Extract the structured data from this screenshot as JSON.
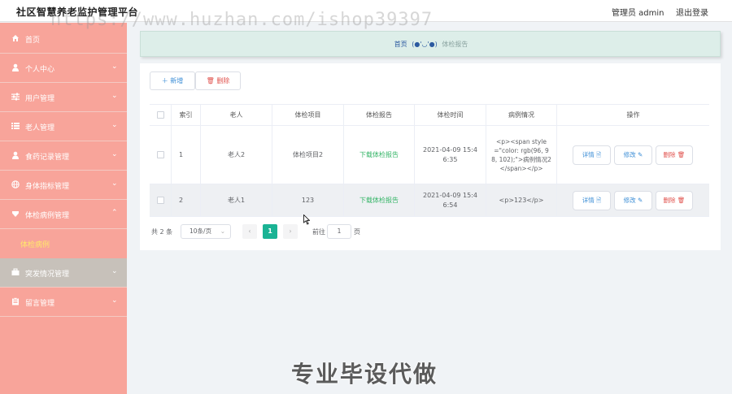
{
  "app": {
    "title": "社区智慧养老监护管理平台",
    "user_label": "管理员 admin",
    "logout_label": "退出登录"
  },
  "watermark": "https://www.huzhan.com/ishop39397",
  "footer_watermark": "专业毕设代做",
  "colors": {
    "sidebar_bg": "#f8a49a",
    "active_sub": "#ffe86b",
    "primary": "#1ab394",
    "download": "#35b567",
    "danger": "#e0514c",
    "link": "#3b8dd6"
  },
  "sidebar": {
    "items": [
      {
        "label": "首页",
        "icon": "home-icon",
        "expandable": false
      },
      {
        "label": "个人中心",
        "icon": "person-icon",
        "expandable": true
      },
      {
        "label": "用户管理",
        "icon": "sliders-icon",
        "expandable": true
      },
      {
        "label": "老人管理",
        "icon": "list-icon",
        "expandable": true
      },
      {
        "label": "食药记录管理",
        "icon": "person-icon",
        "expandable": true
      },
      {
        "label": "身体指标管理",
        "icon": "globe-icon",
        "expandable": true
      },
      {
        "label": "体检病例管理",
        "icon": "diamond-icon",
        "expandable": true,
        "expanded": true
      },
      {
        "label": "突发情况管理",
        "icon": "briefcase-icon",
        "expandable": true,
        "hovered": true
      },
      {
        "label": "留言管理",
        "icon": "clipboard-icon",
        "expandable": true
      }
    ],
    "sub_active": "体检病例"
  },
  "breadcrumb": {
    "home": "首页",
    "face": "(●'◡'●)",
    "current": "体检报告"
  },
  "toolbar": {
    "add_label": "新增",
    "delete_label": "删除"
  },
  "table": {
    "columns": [
      "索引",
      "老人",
      "体检项目",
      "体检报告",
      "体检时间",
      "病例情况",
      "操作"
    ],
    "rows": [
      {
        "index": "1",
        "elder": "老人2",
        "item": "体检项目2",
        "report": "下载体检报告",
        "time": "2021-04-09 15:46:35",
        "case": "<p><span style=\"color: rgb(96, 98, 102);\">病例情况2</span></p>"
      },
      {
        "index": "2",
        "elder": "老人1",
        "item": "123",
        "report": "下载体检报告",
        "time": "2021-04-09 15:46:54",
        "case": "<p>123</p>"
      }
    ],
    "actions": {
      "detail": "详情",
      "edit": "修改",
      "delete": "删除"
    }
  },
  "pagination": {
    "total": "共 2 条",
    "page_size": "10条/页",
    "current_page": "1",
    "goto_label": "前往",
    "goto_value": "1",
    "page_suffix": "页"
  }
}
